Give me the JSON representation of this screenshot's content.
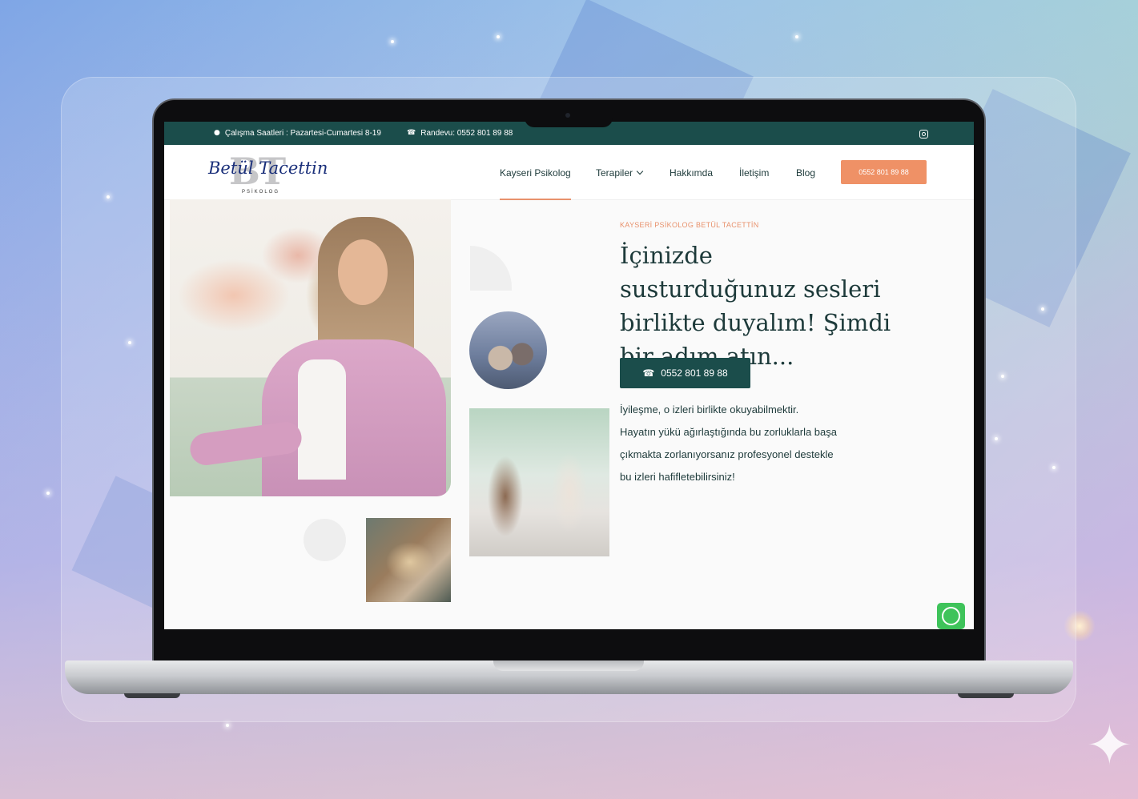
{
  "topbar": {
    "hours_text": "Çalışma Saatleri : Pazartesi-Cumartesi 8-19",
    "phone_text": "Randevu: 0552 801 89 88"
  },
  "logo": {
    "monogram": "BT",
    "script_name": "Betül Tacettin",
    "subtitle": "PSİKOLOG"
  },
  "nav": {
    "items": [
      {
        "label": "Kayseri Psikolog",
        "active": true
      },
      {
        "label": "Terapiler",
        "has_dropdown": true
      },
      {
        "label": "Hakkımda"
      },
      {
        "label": "İletişim"
      },
      {
        "label": "Blog"
      }
    ],
    "cta_label": "0552 801 89 88"
  },
  "hero": {
    "eyebrow": "KAYSERİ PSİKOLOG BETÜL TACETTİN",
    "headline": "İçinizde susturduğunuz sesleri birlikte duyalım! Şimdi bir adım atın...",
    "cta_label": "0552 801 89 88",
    "body_lines": [
      "İyileşme, o izleri birlikte okuyabilmektir.",
      "Hayatın yükü ağırlaştığında bu zorluklarla başa",
      "çıkmakta zorlanıyorsanız profesyonel destekle",
      "bu izleri hafifletebilirsiniz!"
    ]
  },
  "icons": {
    "clock": "clock-icon",
    "phone": "phone-icon",
    "instagram": "instagram-icon",
    "whatsapp": "whatsapp-icon"
  },
  "colors": {
    "primary_teal": "#1b4d4b",
    "accent_orange": "#ef9166",
    "whatsapp_green": "#3ec35a"
  }
}
